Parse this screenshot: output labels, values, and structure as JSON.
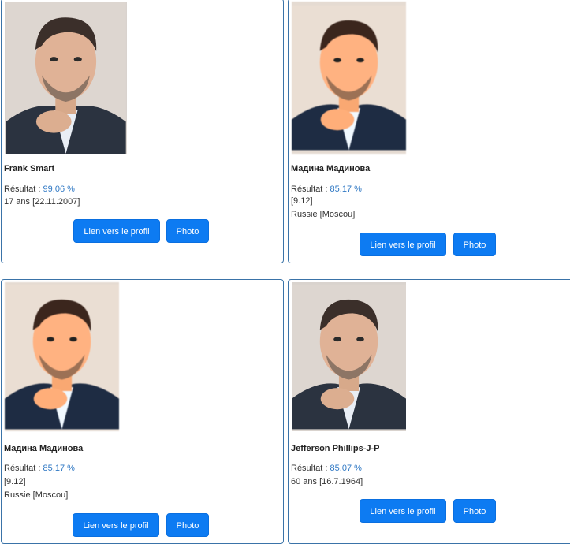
{
  "results": [
    {
      "name": "Frank Smart",
      "result_label": "Résultat : ",
      "result_value": "99.06 %",
      "detail_1": "17 ans [22.11.2007]",
      "detail_2": "",
      "profile_button": "Lien vers le profil",
      "photo_button": "Photo"
    },
    {
      "name": "Мадина Мадинова",
      "result_label": "Résultat : ",
      "result_value": "85.17 %",
      "detail_1": "[9.12]",
      "detail_2": "Russie [Moscou]",
      "profile_button": "Lien vers le profil",
      "photo_button": "Photo"
    },
    {
      "name": "Мадина Мадинова",
      "result_label": "Résultat : ",
      "result_value": "85.17 %",
      "detail_1": "[9.12]",
      "detail_2": "Russie [Moscou]",
      "profile_button": "Lien vers le profil",
      "photo_button": "Photo"
    },
    {
      "name": "Jefferson Phillips-J-P",
      "result_label": "Résultat : ",
      "result_value": "85.07 %",
      "detail_1": "60 ans [16.7.1964]",
      "detail_2": "",
      "profile_button": "Lien vers le profil",
      "photo_button": "Photo"
    }
  ],
  "colors": {
    "card_border": "#3a73a8",
    "button": "#0d7bf2",
    "result_value": "#2f78c4"
  }
}
